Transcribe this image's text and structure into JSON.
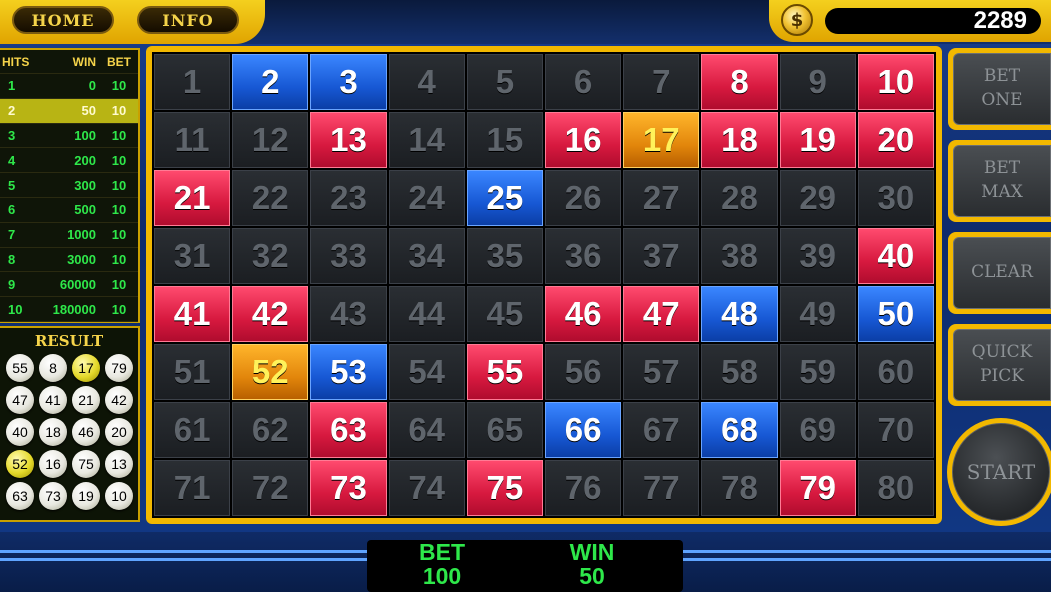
{
  "top": {
    "home_label": "HOME",
    "info_label": "INFO",
    "coin_symbol": "$",
    "credits": "2289"
  },
  "paytable": {
    "headers": {
      "hits": "HITS",
      "win": "WIN",
      "bet": "BET"
    },
    "rows": [
      {
        "hits": "1",
        "win": "0",
        "bet": "10"
      },
      {
        "hits": "2",
        "win": "50",
        "bet": "10"
      },
      {
        "hits": "3",
        "win": "100",
        "bet": "10"
      },
      {
        "hits": "4",
        "win": "200",
        "bet": "10"
      },
      {
        "hits": "5",
        "win": "300",
        "bet": "10"
      },
      {
        "hits": "6",
        "win": "500",
        "bet": "10"
      },
      {
        "hits": "7",
        "win": "1000",
        "bet": "10"
      },
      {
        "hits": "8",
        "win": "3000",
        "bet": "10"
      },
      {
        "hits": "9",
        "win": "60000",
        "bet": "10"
      },
      {
        "hits": "10",
        "win": "180000",
        "bet": "10"
      }
    ],
    "active_index": 1
  },
  "result": {
    "title": "RESULT",
    "balls": [
      55,
      8,
      17,
      79,
      47,
      41,
      21,
      42,
      40,
      18,
      46,
      20,
      52,
      16,
      75,
      13,
      63,
      73,
      19,
      10
    ],
    "hit_balls": [
      17,
      52
    ]
  },
  "board": {
    "numbers": [
      1,
      2,
      3,
      4,
      5,
      6,
      7,
      8,
      9,
      10,
      11,
      12,
      13,
      14,
      15,
      16,
      17,
      18,
      19,
      20,
      21,
      22,
      23,
      24,
      25,
      26,
      27,
      28,
      29,
      30,
      31,
      32,
      33,
      34,
      35,
      36,
      37,
      38,
      39,
      40,
      41,
      42,
      43,
      44,
      45,
      46,
      47,
      48,
      49,
      50,
      51,
      52,
      53,
      54,
      55,
      56,
      57,
      58,
      59,
      60,
      61,
      62,
      63,
      64,
      65,
      66,
      67,
      68,
      69,
      70,
      71,
      72,
      73,
      74,
      75,
      76,
      77,
      78,
      79,
      80
    ],
    "drawn": [
      8,
      10,
      13,
      16,
      18,
      19,
      20,
      21,
      40,
      41,
      42,
      46,
      47,
      55,
      63,
      73,
      75,
      79
    ],
    "picked": [
      2,
      3,
      25,
      48,
      50,
      53,
      66,
      68
    ],
    "matched": [
      17,
      52
    ],
    "colors": {
      "drawn": "#d7193f",
      "picked": "#1758d4",
      "matched": "#e2860b",
      "idle": "#1b1e22"
    }
  },
  "controls": {
    "bet_one": "BET\nONE",
    "bet_max": "BET\nMAX",
    "clear": "CLEAR",
    "quick_pick": "QUICK\nPICK",
    "start": "START"
  },
  "bottom": {
    "bet_label": "BET",
    "bet_value": "100",
    "win_label": "WIN",
    "win_value": "50"
  }
}
